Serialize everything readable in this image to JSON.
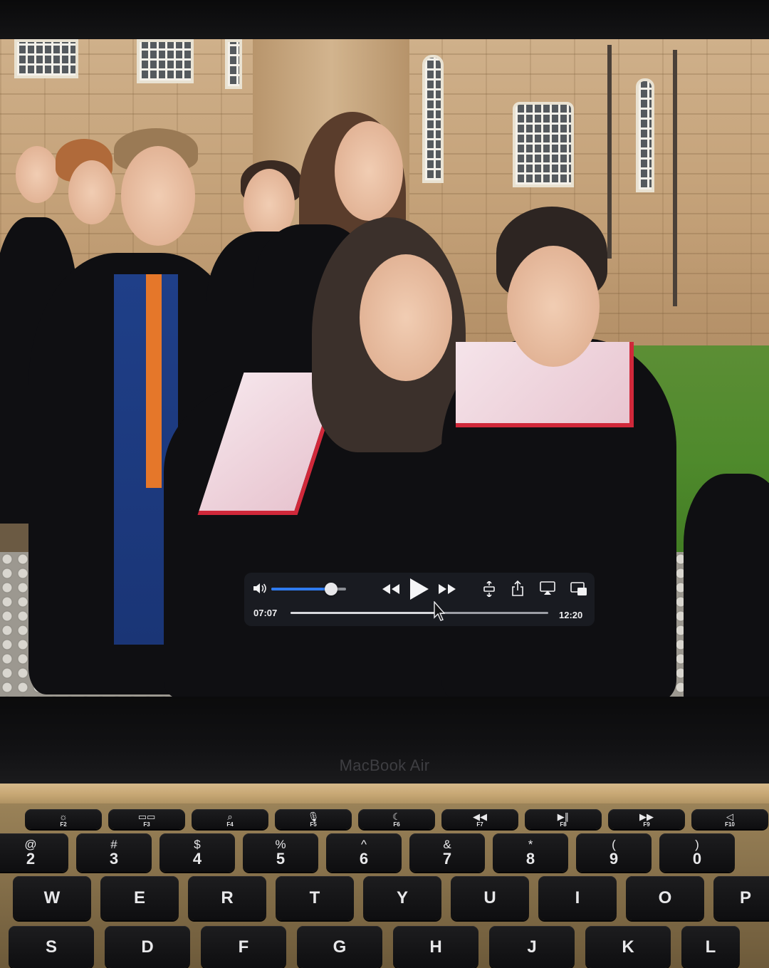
{
  "laptop": {
    "brand": "MacBook Air"
  },
  "player": {
    "elapsed": "07:07",
    "duration": "12:20",
    "volume_level": 0.8,
    "playback_progress": 0.57,
    "state": "paused",
    "icons": [
      "volume-icon",
      "rewind-icon",
      "play-icon",
      "fast-forward-icon",
      "rotate-icon",
      "share-icon",
      "airplay-icon",
      "picture-in-picture-icon"
    ]
  },
  "keyboard": {
    "function_row": [
      {
        "glyph": "☼",
        "label": "F2"
      },
      {
        "glyph": "▭▭",
        "label": "F3"
      },
      {
        "glyph": "⌕",
        "label": "F4"
      },
      {
        "glyph": "🎙",
        "label": "F5"
      },
      {
        "glyph": "☾",
        "label": "F6"
      },
      {
        "glyph": "◀◀",
        "label": "F7"
      },
      {
        "glyph": "▶∥",
        "label": "F8"
      },
      {
        "glyph": "▶▶",
        "label": "F9"
      },
      {
        "glyph": "◁",
        "label": "F10"
      }
    ],
    "number_row": [
      {
        "top": "@",
        "bottom": "2"
      },
      {
        "top": "#",
        "bottom": "3"
      },
      {
        "top": "$",
        "bottom": "4"
      },
      {
        "top": "%",
        "bottom": "5"
      },
      {
        "top": "^",
        "bottom": "6"
      },
      {
        "top": "&",
        "bottom": "7"
      },
      {
        "top": "*",
        "bottom": "8"
      },
      {
        "top": "(",
        "bottom": "9"
      },
      {
        "top": ")",
        "bottom": "0"
      }
    ],
    "qwerty_row": [
      "W",
      "E",
      "R",
      "T",
      "Y",
      "U",
      "I",
      "O",
      "P"
    ],
    "home_row": [
      "S",
      "D",
      "F",
      "G",
      "H",
      "J",
      "K",
      "L"
    ]
  }
}
